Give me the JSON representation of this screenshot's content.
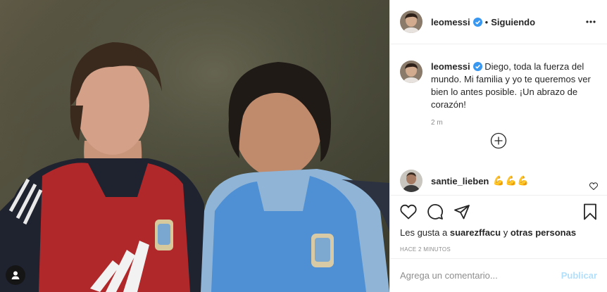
{
  "post": {
    "username": "leomessi",
    "follow_label": "Siguiendo",
    "separator": "•",
    "caption": "Diego, toda la fuerza del mundo. Mi familia y yo te queremos ver bien lo antes posible. ¡Un abrazo de corazón!",
    "time_short": "2 m",
    "likes_prefix": "Les gusta a",
    "likes_user": "suarezffacu",
    "likes_join": "y",
    "likes_others": "otras personas",
    "time_ago": "HACE 2 MINUTOS"
  },
  "comments": [
    {
      "username": "santie_lieben",
      "text": "💪💪💪"
    }
  ],
  "composer": {
    "placeholder": "Agrega un comentario...",
    "publish_label": "Publicar"
  },
  "icons": {
    "verified": "verified-badge-icon",
    "more": "more-options-icon",
    "load_more": "plus-circle-icon",
    "like": "heart-icon",
    "comment": "comment-icon",
    "share": "paper-plane-icon",
    "save": "bookmark-icon",
    "tags": "user-tag-icon"
  },
  "colors": {
    "verified": "#3897f0",
    "publish_disabled": "#b2dffc",
    "secondary_text": "#8e8e8e"
  }
}
